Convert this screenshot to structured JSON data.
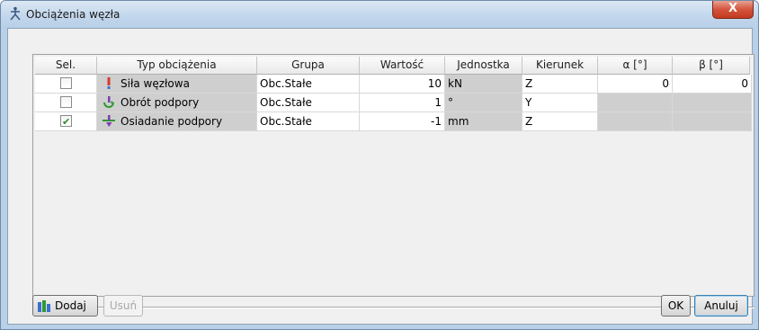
{
  "window": {
    "title": "Obciążenia węzła",
    "close_label": "X"
  },
  "table": {
    "headers": [
      "Sel.",
      "Typ obciążenia",
      "Grupa",
      "Wartość",
      "Jednostka",
      "Kierunek",
      "α [°]",
      "β [°]"
    ],
    "rows": [
      {
        "selected": false,
        "icon": "nodal-force-icon",
        "type": "Siła węzłowa",
        "group": "Obc.Stałe",
        "value": "10",
        "unit": "kN",
        "direction": "Z",
        "alpha": "0",
        "beta": "0"
      },
      {
        "selected": false,
        "icon": "support-rotation-icon",
        "type": "Obrót podpory",
        "group": "Obc.Stałe",
        "value": "1",
        "unit": "°",
        "direction": "Y",
        "alpha": "",
        "beta": ""
      },
      {
        "selected": true,
        "icon": "support-settlement-icon",
        "type": "Osiadanie podpory",
        "group": "Obc.Stałe",
        "value": "-1",
        "unit": "mm",
        "direction": "Z",
        "alpha": "",
        "beta": ""
      }
    ]
  },
  "buttons": {
    "add": "Dodaj",
    "remove": "Usuń",
    "ok": "OK",
    "cancel": "Anuluj"
  },
  "colors": {
    "window_frame": "#b8d0e8",
    "close_red": "#c23a20",
    "gray_cell": "#cfcfcf",
    "check_green": "#2a8a2a"
  }
}
